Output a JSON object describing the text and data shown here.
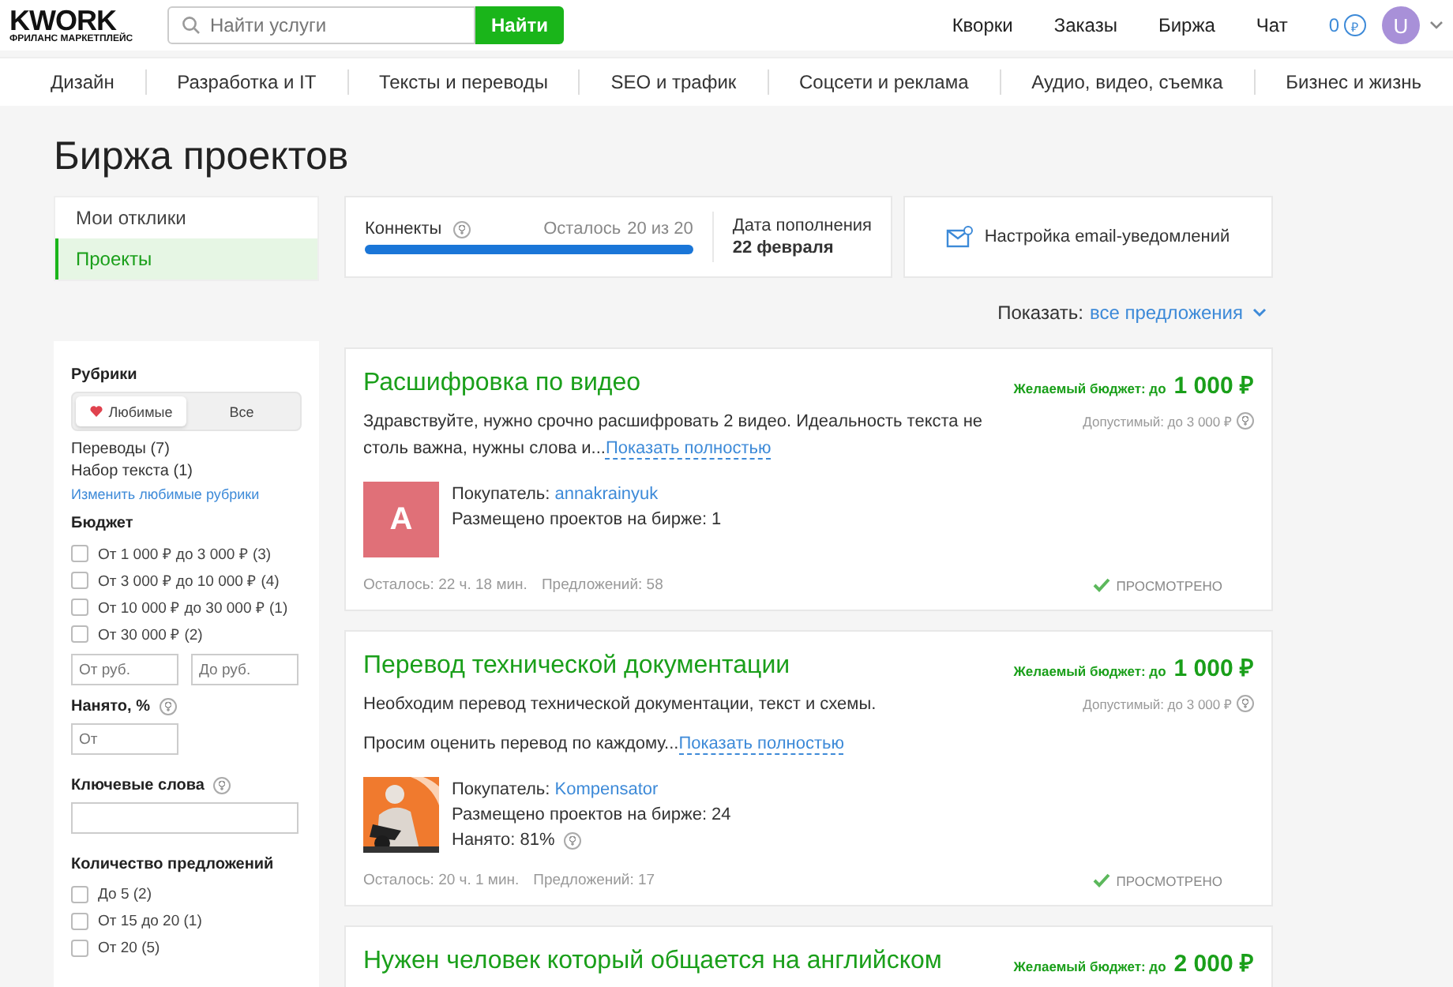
{
  "header": {
    "logo": "KWORK",
    "logo_subtitle": "ФРИЛАНС МАРКЕТПЛЕЙС",
    "search": {
      "placeholder": "Найти услуги",
      "button": "Найти"
    },
    "nav": [
      "Кворки",
      "Заказы",
      "Биржа",
      "Чат"
    ],
    "balance": "0",
    "currency": "₽",
    "avatar": "U"
  },
  "categories": [
    "Дизайн",
    "Разработка и IT",
    "Тексты и переводы",
    "SEO и трафик",
    "Соцсети и реклама",
    "Аудио, видео, съемка",
    "Бизнес и жизнь"
  ],
  "page_title": "Биржа проектов",
  "tabs": [
    {
      "label": "Мои отклики",
      "selected": false
    },
    {
      "label": "Проекты",
      "selected": true
    }
  ],
  "connects": {
    "label": "Коннекты",
    "remaining_label": "Осталось",
    "remaining": "20 из 20",
    "level": 1,
    "refill_label": "Дата пополнения",
    "refill_date": "22 февраля"
  },
  "email_settings": "Настройка email-уведомлений",
  "show": {
    "label": "Показать:",
    "value": "все предложения"
  },
  "filters": {
    "rubrics": {
      "title": "Рубрики",
      "toggle": [
        {
          "label": "Любимые",
          "selected": true
        },
        {
          "label": "Все",
          "selected": false
        }
      ],
      "items": [
        "Переводы (7)",
        "Набор текста (1)"
      ],
      "link": "Изменить любимые рубрики"
    },
    "budget": {
      "title": "Бюджет",
      "options": [
        {
          "label": "От 1 000 ₽ до 3 000 ₽ (3)",
          "checked": false
        },
        {
          "label": "От 3 000 ₽ до 10 000 ₽ (4)",
          "checked": false
        },
        {
          "label": "От 10 000 ₽ до 30 000 ₽ (1)",
          "checked": false
        },
        {
          "label": "От 30 000 ₽ (2)",
          "checked": false
        }
      ],
      "from_placeholder": "От руб.",
      "to_placeholder": "До руб."
    },
    "hired": {
      "title": "Нанято, %",
      "placeholder": "От"
    },
    "keywords": {
      "title": "Ключевые слова"
    },
    "offers": {
      "title": "Количество предложений",
      "options": [
        {
          "label": "До 5 (2)",
          "checked": false
        },
        {
          "label": "От 15 до 20 (1)",
          "checked": false
        },
        {
          "label": "От 20 (5)",
          "checked": false
        }
      ]
    }
  },
  "projects": [
    {
      "title": "Расшифровка по видео",
      "budget_label": "Желаемый бюджет: до",
      "budget": "1 000 ₽",
      "allowed": "Допустимый: до 3 000 ₽",
      "description": [
        "Здравствуйте, нужно срочно расшифровать 2 видео. Идеальность текста не столь важна, нужны слова и..."
      ],
      "more": "Показать полностью",
      "avatar": {
        "kind": "letter",
        "letter": "A",
        "color": "#e07078"
      },
      "buyer_label": "Покупатель:",
      "buyer": "annakrainyuk",
      "posted": "Размещено проектов на бирже: 1",
      "time_left": "Осталось: 22 ч. 18 мин.",
      "offers": "Предложений: 58",
      "viewed": true,
      "status": "ПРОСМОТРЕНО"
    },
    {
      "title": "Перевод технической документации",
      "budget_label": "Желаемый бюджет: до",
      "budget": "1 000 ₽",
      "allowed": "Допустимый: до 3 000 ₽",
      "description": [
        "Необходим перевод технической документации, текст и схемы.",
        "Просим оценить перевод по каждому..."
      ],
      "more": "Показать полностью",
      "avatar": {
        "kind": "picture"
      },
      "buyer_label": "Покупатель:",
      "buyer": "Kompensator",
      "posted": "Размещено проектов на бирже: 24",
      "hired": "Нанято: 81%",
      "time_left": "Осталось: 20 ч. 1 мин.",
      "offers": "Предложений: 17",
      "viewed": true,
      "status": "ПРОСМОТРЕНО"
    },
    {
      "title": "Нужен человек который общается на английском",
      "budget_label": "Желаемый бюджет: до",
      "budget": "2 000 ₽"
    }
  ]
}
